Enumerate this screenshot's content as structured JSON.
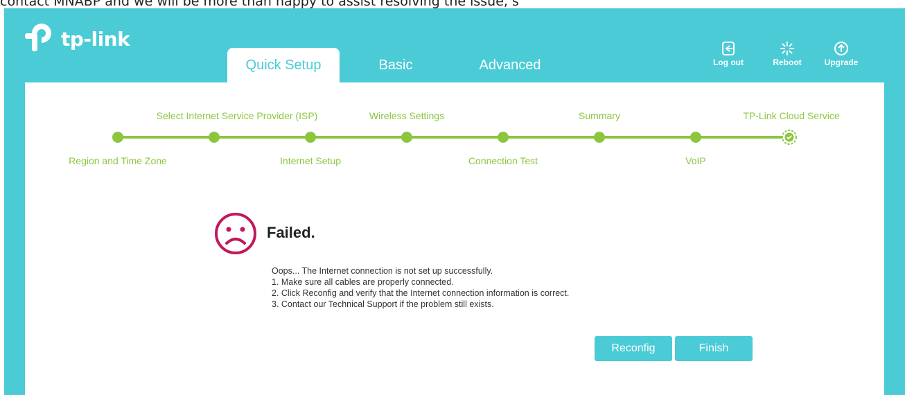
{
  "page_caption": "contact MNABP and we will be more than happy to assist resolving the issue, s",
  "brand": {
    "name": "tp-link",
    "color": "#4acbd6",
    "accent": "#8cc63f",
    "sad_color": "#c2185b"
  },
  "tabs": [
    {
      "label": "Quick Setup",
      "active": true
    },
    {
      "label": "Basic",
      "active": false
    },
    {
      "label": "Advanced",
      "active": false
    }
  ],
  "header_actions": {
    "logout": {
      "label": "Log out",
      "icon": "logout-icon"
    },
    "reboot": {
      "label": "Reboot",
      "icon": "reboot-icon"
    },
    "upgrade": {
      "label": "Upgrade",
      "icon": "upgrade-icon"
    }
  },
  "steps": {
    "region": "Region and Time Zone",
    "isp": "Select Internet Service Provider (ISP)",
    "internet": "Internet Setup",
    "wireless": "Wireless Settings",
    "connection": "Connection Test",
    "summary": "Summary",
    "voip": "VoIP",
    "cloud": "TP-Link Cloud Service"
  },
  "result": {
    "icon": "sad-face-icon",
    "title": "Failed.",
    "lines": [
      "Oops... The Internet connection is not set up successfully.",
      "1. Make sure all cables are properly connected.",
      "2. Click Reconfig and verify that the Internet connection information is correct.",
      "3. Contact our Technical Support if the problem still exists."
    ]
  },
  "buttons": {
    "reconfig": "Reconfig",
    "finish": "Finish"
  }
}
